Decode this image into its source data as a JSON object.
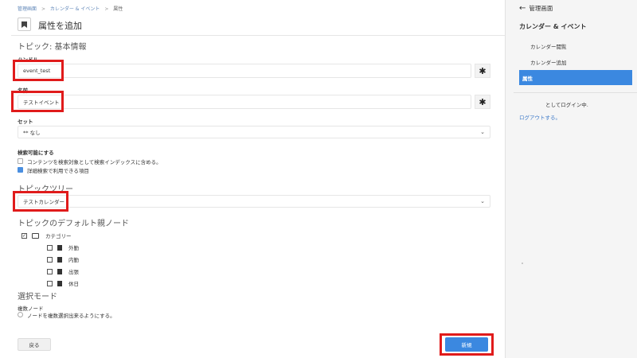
{
  "breadcrumb": [
    "管理画面",
    "カレンダー & イベント",
    "属性"
  ],
  "breadcrumb_sep": ">",
  "page": {
    "title": "属性を追加"
  },
  "sections": {
    "topic_basic": "トピック: 基本情報",
    "topic_tree": "トピックツリー",
    "default_parent": "トピックのデフォルト親ノード",
    "select_mode": "選択モード"
  },
  "fields": {
    "handle_label": "ハンドル",
    "handle_value": "event_test",
    "name_label": "名前",
    "name_value": "テストイベント",
    "set_label": "セット",
    "set_value": "** なし",
    "required_mark": "✱"
  },
  "searchable": {
    "label": "検索可能にする",
    "option1": {
      "text": "コンテンツを検索対象として検索インデックスに含める。",
      "checked": false
    },
    "option2": {
      "text": "詳細検索で利用できる項目",
      "checked": true
    }
  },
  "tree_select": {
    "value": "テストカレンダー"
  },
  "tree": {
    "root": {
      "label": "カテゴリー",
      "checked": true
    },
    "children": [
      "外勤",
      "内勤",
      "出張",
      "休日"
    ]
  },
  "select_mode": {
    "sub_label": "複数ノード",
    "option": "ノードを複数選択出来るようにする。"
  },
  "buttons": {
    "back": "戻る",
    "new": "新規"
  },
  "sidebar": {
    "back_label": "管理画面",
    "heading": "カレンダー & イベント",
    "items": [
      {
        "label": "カレンダー閲覧",
        "active": false
      },
      {
        "label": "カレンダー追加",
        "active": false
      },
      {
        "label": "属性",
        "active": true
      }
    ],
    "login_text": "としてログイン中.",
    "logout_text": "ログアウトする。"
  },
  "colors": {
    "accent": "#3b88e0",
    "highlight": "#e01b1b"
  },
  "icons": {
    "title": "bookmark-icon",
    "chevron": "chevron-down-icon",
    "back": "arrow-left-icon",
    "folder": "folder-icon",
    "file": "file-icon",
    "required": "asterisk-icon"
  }
}
